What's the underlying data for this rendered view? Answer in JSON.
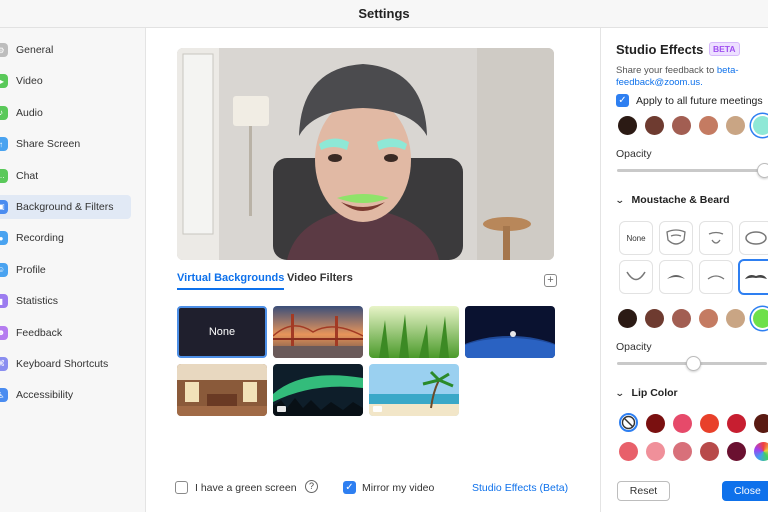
{
  "window": {
    "title": "Settings"
  },
  "sidebar": {
    "items": [
      {
        "label": "General",
        "icon": "gear-icon",
        "color": "#bdbdbd",
        "active": false
      },
      {
        "label": "Video",
        "icon": "video-icon",
        "color": "#5ac95a",
        "active": false
      },
      {
        "label": "Audio",
        "icon": "headphones-icon",
        "color": "#5ac95a",
        "active": false
      },
      {
        "label": "Share Screen",
        "icon": "share-screen-icon",
        "color": "#4aa3f0",
        "active": false
      },
      {
        "label": "Chat",
        "icon": "chat-icon",
        "color": "#5ac95a",
        "active": false
      },
      {
        "label": "Background & Filters",
        "icon": "background-icon",
        "color": "#4a8cf0",
        "active": true
      },
      {
        "label": "Recording",
        "icon": "recording-icon",
        "color": "#4aa3f0",
        "active": false
      },
      {
        "label": "Profile",
        "icon": "profile-icon",
        "color": "#4aa3f0",
        "active": false
      },
      {
        "label": "Statistics",
        "icon": "statistics-icon",
        "color": "#9c7cf0",
        "active": false
      },
      {
        "label": "Feedback",
        "icon": "feedback-icon",
        "color": "#b57cf0",
        "active": false
      },
      {
        "label": "Keyboard Shortcuts",
        "icon": "keyboard-icon",
        "color": "#8a8ef0",
        "active": false
      },
      {
        "label": "Accessibility",
        "icon": "accessibility-icon",
        "color": "#4a8cf0",
        "active": false
      }
    ]
  },
  "main": {
    "tabs": [
      {
        "label": "Virtual Backgrounds",
        "active": true
      },
      {
        "label": "Video Filters",
        "active": false
      }
    ],
    "backgrounds": {
      "none_label": "None",
      "items": [
        "golden-gate-bridge",
        "grass",
        "earth-from-space",
        "interior-room",
        "aurora",
        "beach"
      ]
    },
    "green_screen_label": "I have a green screen",
    "mirror_label": "Mirror my video",
    "studio_effects_link": "Studio Effects (Beta)",
    "green_screen_checked": false,
    "mirror_checked": true
  },
  "studio": {
    "title": "Studio Effects",
    "beta_badge": "BETA",
    "feedback_text": "Share your feedback to",
    "feedback_email": "beta-feedback@zoom.us.",
    "apply_label": "Apply to all future meetings",
    "apply_checked": true,
    "eyebrow_colors": [
      "#2b1a14",
      "#6e3b30",
      "#a25e52",
      "#c47b62",
      "#c9a584",
      "#8ee8d6"
    ],
    "opacity_label": "Opacity",
    "opacity_1": 0.95,
    "moustache_title": "Moustache & Beard",
    "moustache_none_label": "None",
    "moustache_colors": [
      "#2b1a14",
      "#6e3b30",
      "#a25e52",
      "#c47b62",
      "#c9a584",
      "#6ee04a"
    ],
    "opacity_2": 0.5,
    "lip_title": "Lip Color",
    "lip_colors_row1": [
      "none",
      "#7a1010",
      "#e64a6a",
      "#e8402a",
      "#c71e30",
      "#5a1a12"
    ],
    "lip_colors_row2": [
      "#e8606a",
      "#f0909a",
      "#d8707a",
      "#b84a4a",
      "#6a1030",
      "rainbow"
    ],
    "reset_label": "Reset",
    "close_label": "Close"
  }
}
